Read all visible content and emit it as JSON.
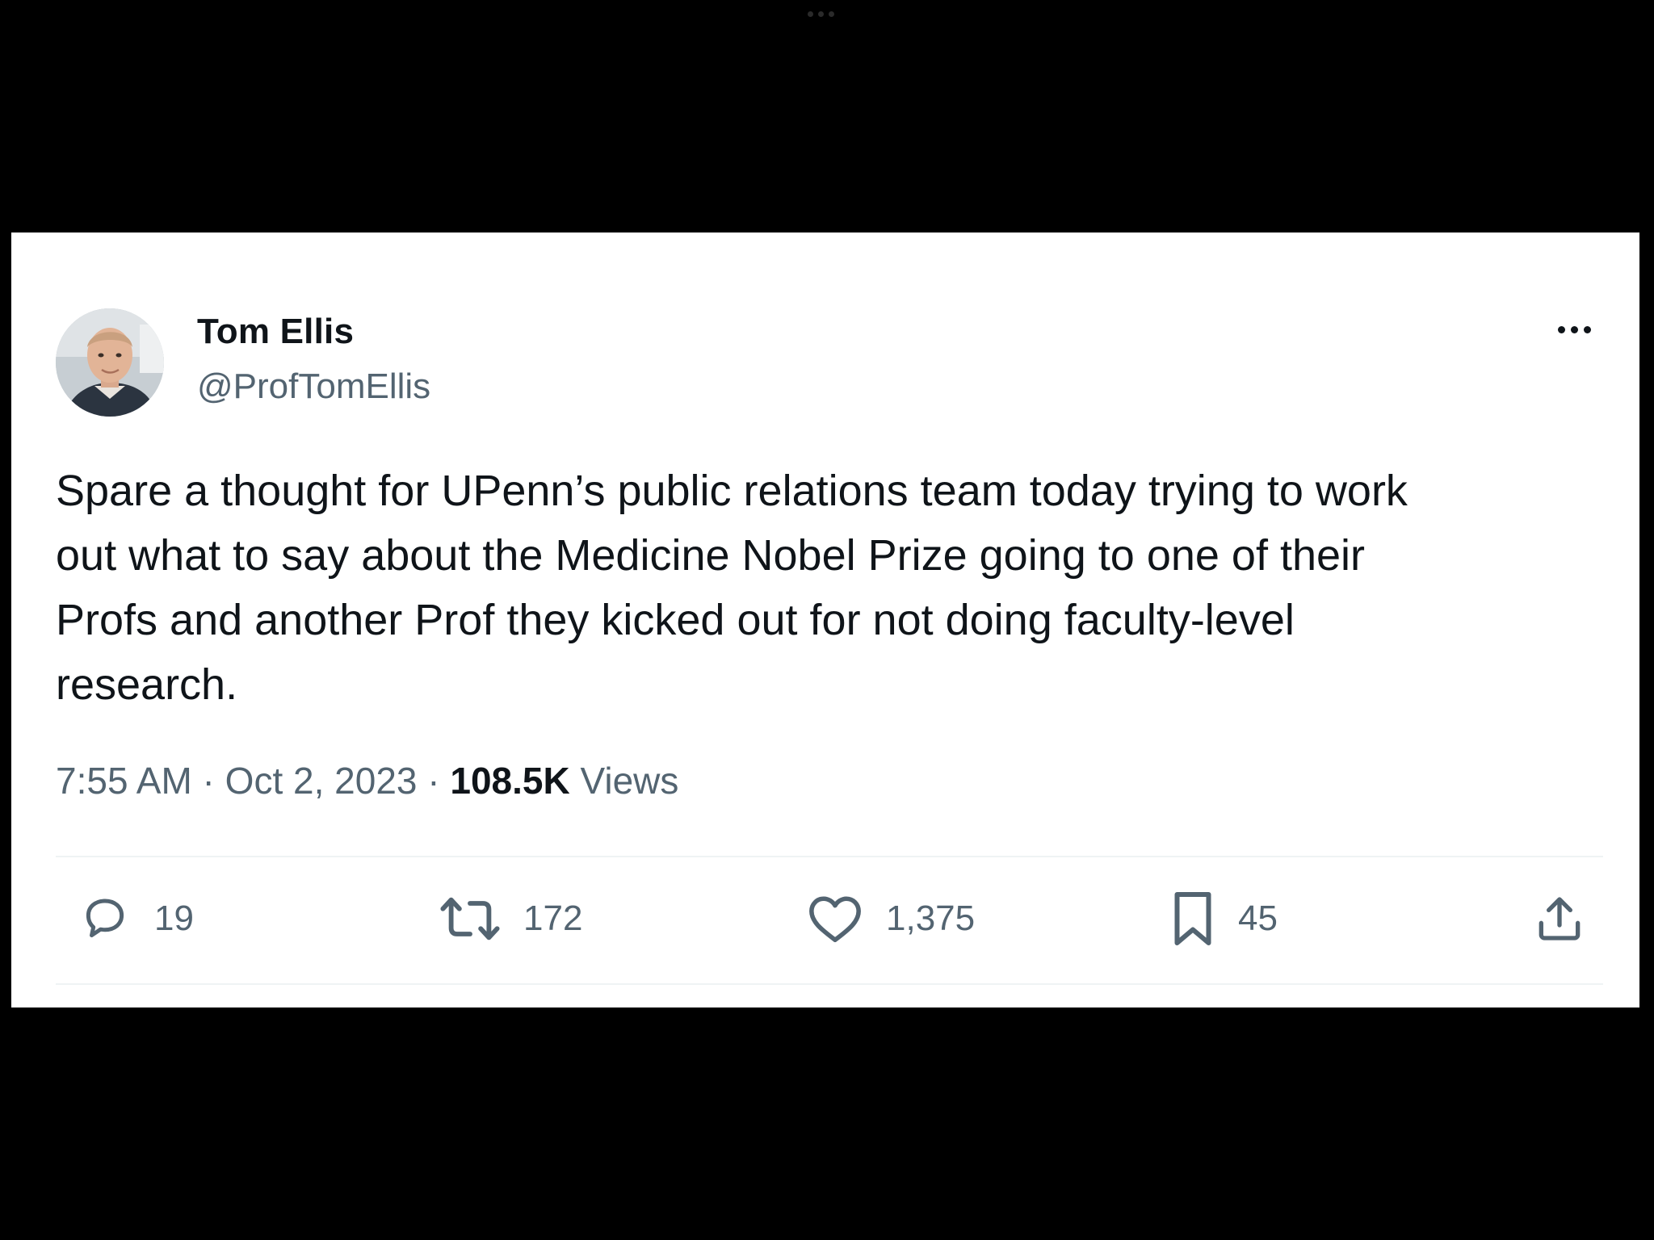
{
  "tweet": {
    "author_name": "Tom Ellis",
    "author_handle": "@ProfTomEllis",
    "text": "Spare a thought for UPenn’s public relations team today trying to work\nout what to say about the Medicine Nobel Prize going to one of their\nProfs and another Prof they kicked out for not doing faculty-level\nresearch.",
    "time": "7:55 AM",
    "separator": " · ",
    "date": "Oct 2, 2023",
    "views_count": "108.5K",
    "views_label": " Views"
  },
  "actions": {
    "reply_count": "19",
    "retweet_count": "172",
    "like_count": "1,375",
    "bookmark_count": "45"
  },
  "icons": {
    "more": "more-horizontal-icon",
    "reply": "reply-icon",
    "retweet": "retweet-icon",
    "like": "heart-icon",
    "bookmark": "bookmark-icon",
    "share": "share-icon"
  },
  "colors": {
    "background": "#000000",
    "card": "#ffffff",
    "text_primary": "#0f1419",
    "text_secondary": "#536471",
    "divider": "#eff3f4"
  }
}
